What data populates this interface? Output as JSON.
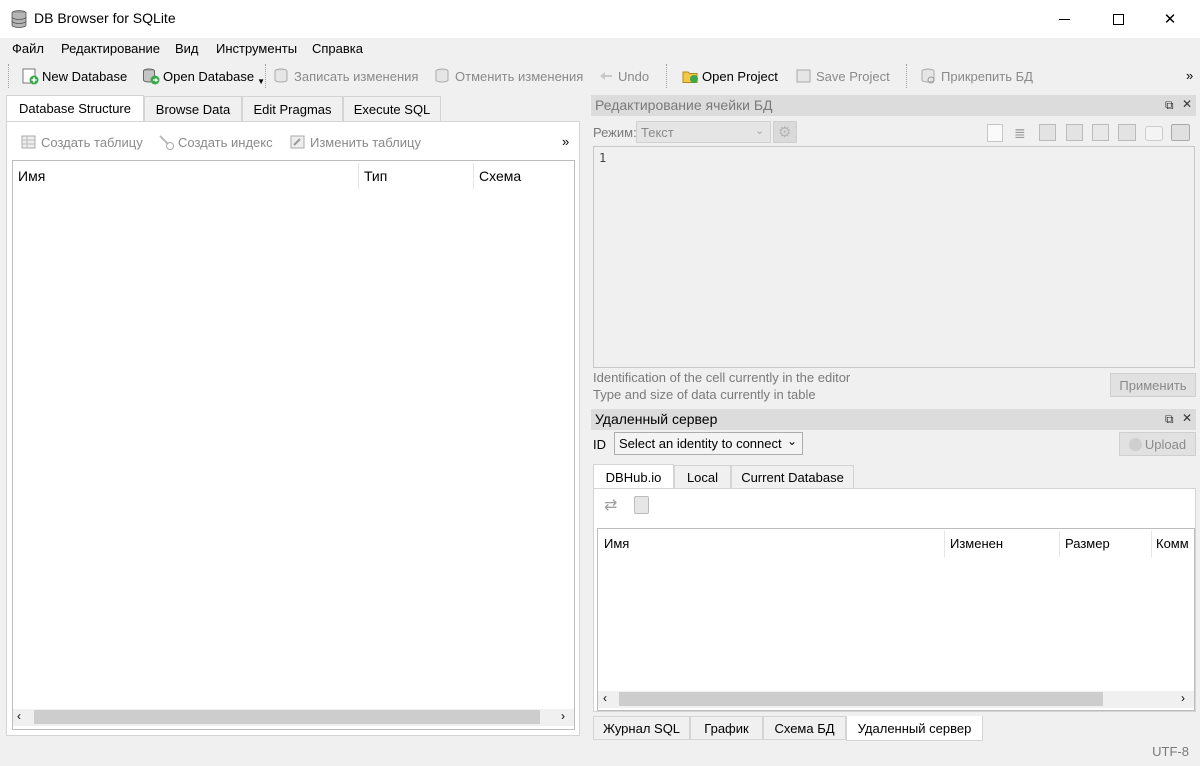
{
  "window": {
    "title": "DB Browser for SQLite",
    "minimize": "—",
    "maximize": "☐",
    "close": "✕"
  },
  "menu": [
    "Файл",
    "Редактирование",
    "Вид",
    "Инструменты",
    "Справка"
  ],
  "toolbar": {
    "new_database": "New Database",
    "open_database": "Open Database",
    "write_changes": "Записать изменения",
    "revert_changes": "Отменить изменения",
    "undo": "Undo",
    "open_project": "Open Project",
    "save_project": "Save Project",
    "attach_db": "Прикрепить БД",
    "more": "»"
  },
  "left_tabs": [
    "Database Structure",
    "Browse Data",
    "Edit Pragmas",
    "Execute SQL"
  ],
  "structure_toolbar": {
    "create_table": "Создать таблицу",
    "create_index": "Создать индекс",
    "modify_table": "Изменить таблицу",
    "more": "»"
  },
  "structure_columns": [
    "Имя",
    "Тип",
    "Схема"
  ],
  "cell_editor": {
    "title": "Редактирование ячейки БД",
    "mode_label": "Режим:",
    "mode_value": "Текст",
    "line_number": "1",
    "info_line1": "Identification of the cell currently in the editor",
    "info_line2": "Type and size of data currently in table",
    "apply": "Применить"
  },
  "remote": {
    "title": "Удаленный сервер",
    "id_label": "ID",
    "identity_placeholder": "Select an identity to connect",
    "upload": "Upload",
    "tabs": [
      "DBHub.io",
      "Local",
      "Current Database"
    ],
    "columns": [
      "Имя",
      "Изменен",
      "Размер",
      "Комм"
    ]
  },
  "bottom_tabs": [
    "Журнал SQL",
    "График",
    "Схема БД",
    "Удаленный сервер"
  ],
  "status": {
    "encoding": "UTF-8"
  },
  "colors": {
    "window_bg": "#f0f0f0",
    "dock_title_bg": "#dcdcdc",
    "disabled_text": "#8a8a8a"
  }
}
